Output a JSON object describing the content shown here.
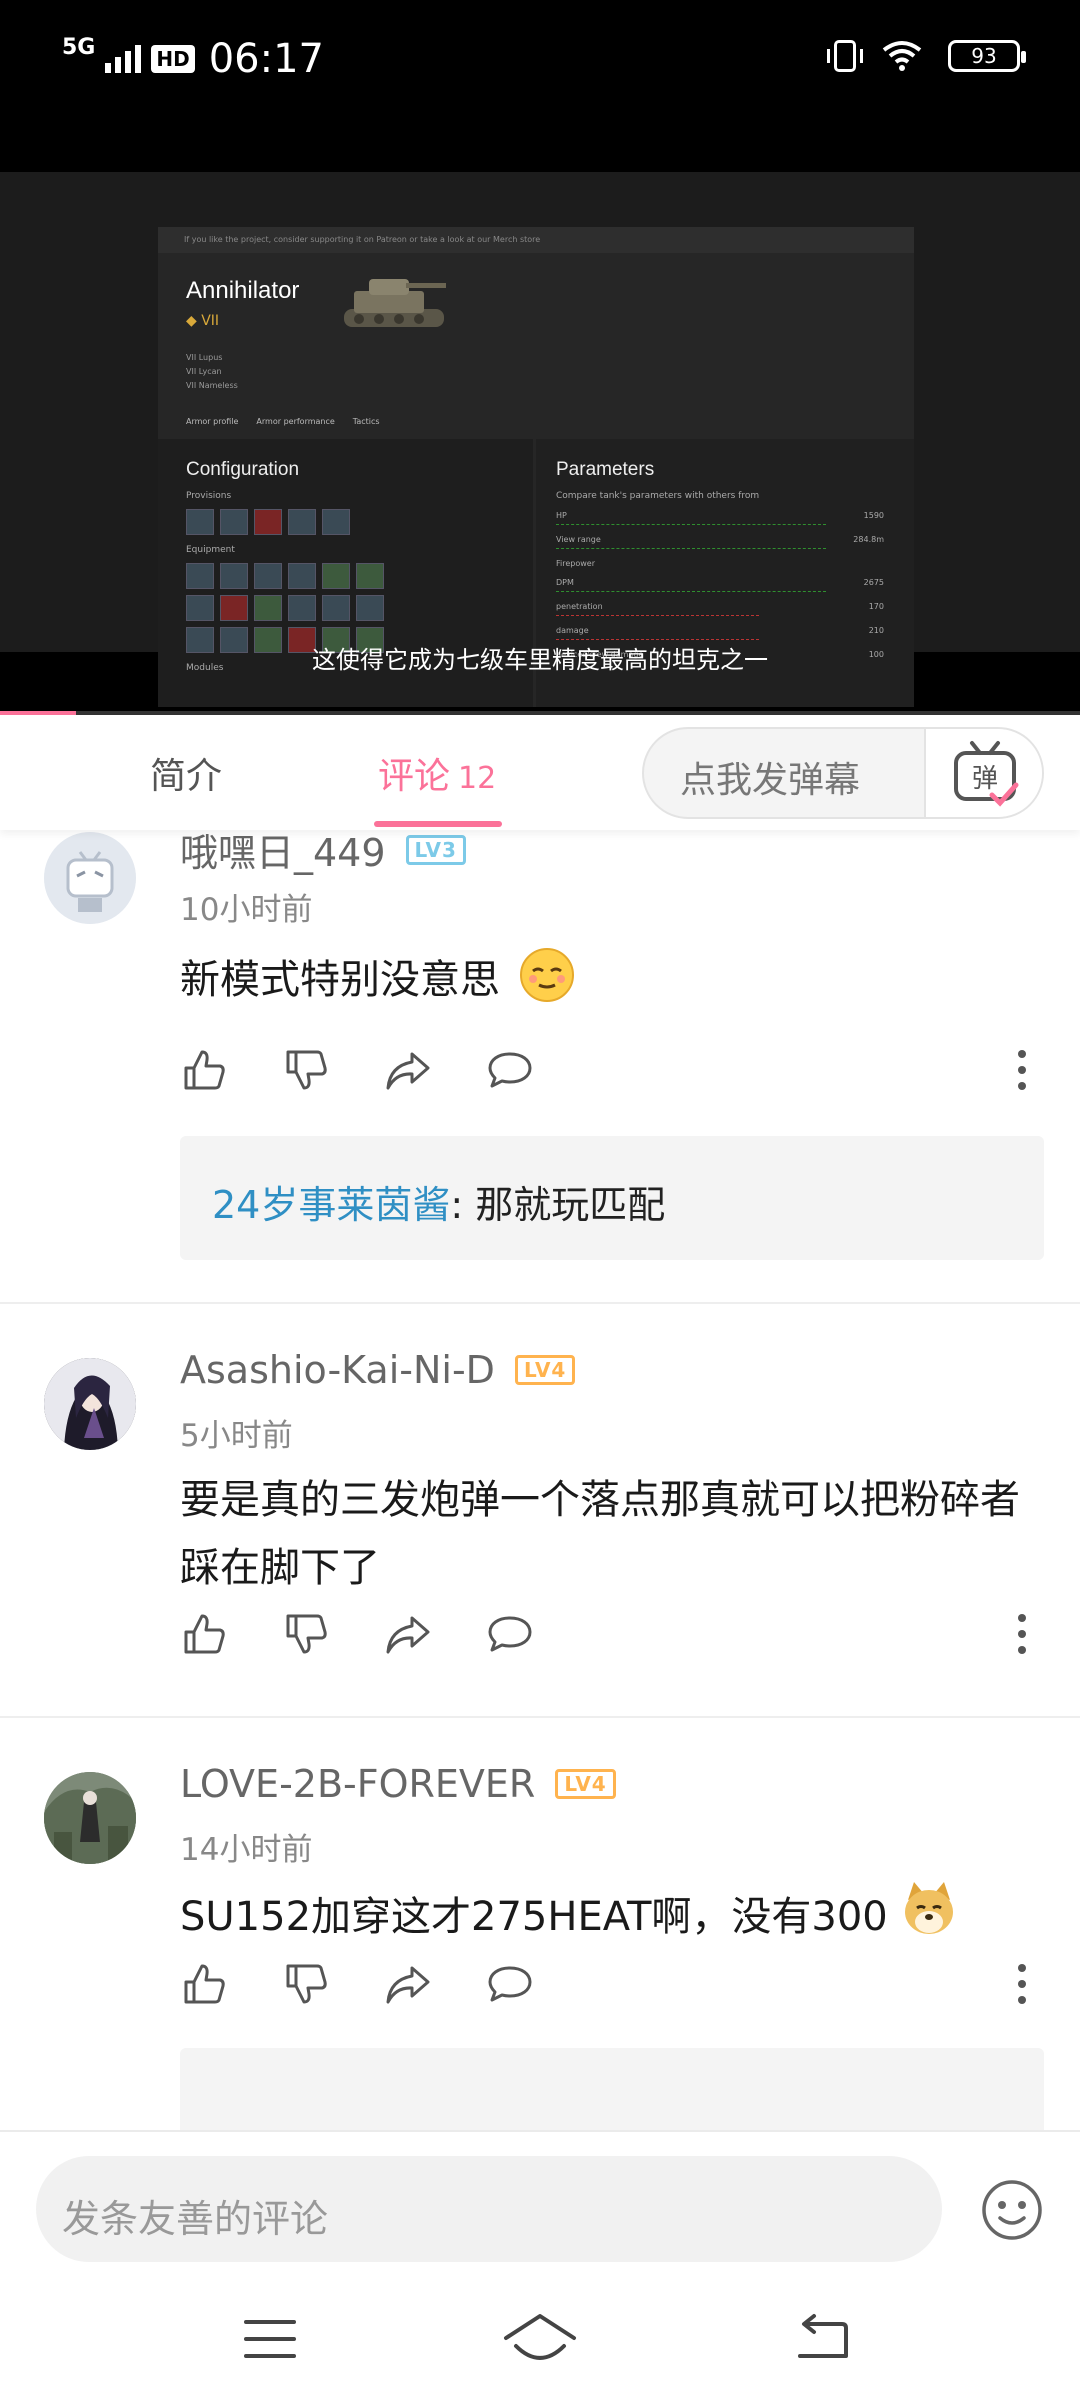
{
  "status_bar": {
    "network": "5G",
    "hd": "HD",
    "time": "06:17",
    "battery": "93"
  },
  "video": {
    "game": {
      "top_note": "If you like the project, consider supporting it on Patreon or take a look at our Merch store",
      "tank_name": "Annihilator",
      "tier": "VII",
      "links": [
        "VII Lupus",
        "VII Lycan",
        "VII Nameless"
      ],
      "tabs": [
        "Armor profile",
        "Armor performance",
        "Tactics"
      ],
      "config_title": "Configuration",
      "provisions_label": "Provisions",
      "equipment_label": "Equipment",
      "modules_label": "Modules",
      "params_title": "Parameters",
      "params_sub": "Compare tank's parameters with others from",
      "stats": [
        {
          "label": "HP",
          "value": "1590"
        },
        {
          "label": "View range",
          "value": "284.8m"
        },
        {
          "label": "Firepower",
          "value": ""
        },
        {
          "label": "DPM",
          "value": "2675"
        },
        {
          "label": "penetration",
          "value": "170"
        },
        {
          "label": "damage",
          "value": "210"
        },
        {
          "label": "devices/crew damage",
          "value": "100"
        }
      ]
    },
    "subtitle": "这使得它成为七级车里精度最高的坦克之一",
    "progress_fraction": 0.07
  },
  "tabs": {
    "intro": "简介",
    "comments": "评论",
    "comments_count": "12",
    "danmaku_placeholder": "点我发弹幕",
    "danmaku_icon_char": "弹"
  },
  "comments": [
    {
      "user": "哦嘿日_449",
      "level": "LV3",
      "time": "10小时前",
      "text": "新模式特别没意思",
      "reply": {
        "user": "24岁事莱茵酱",
        "text": ": 那就玩匹配"
      }
    },
    {
      "user": "Asashio-Kai-Ni-D",
      "level": "LV4",
      "time": "5小时前",
      "text": "要是真的三发炮弹一个落点那真就可以把粉碎者踩在脚下了"
    },
    {
      "user": "LOVE-2B-FOREVER",
      "level": "LV4",
      "time": "14小时前",
      "text": "SU152加穿这才275HEAT啊，没有300"
    }
  ],
  "bottom": {
    "comment_placeholder": "发条友善的评论"
  },
  "colors": {
    "accent": "#fb7299",
    "reply_name": "#2f8fc4",
    "lv3": "#7ccae8",
    "lv4": "#ffb34e"
  },
  "icons": [
    "like-icon",
    "dislike-icon",
    "share-icon",
    "reply-icon",
    "more-icon",
    "emoji-icon",
    "menu-icon",
    "home-icon",
    "back-icon"
  ]
}
